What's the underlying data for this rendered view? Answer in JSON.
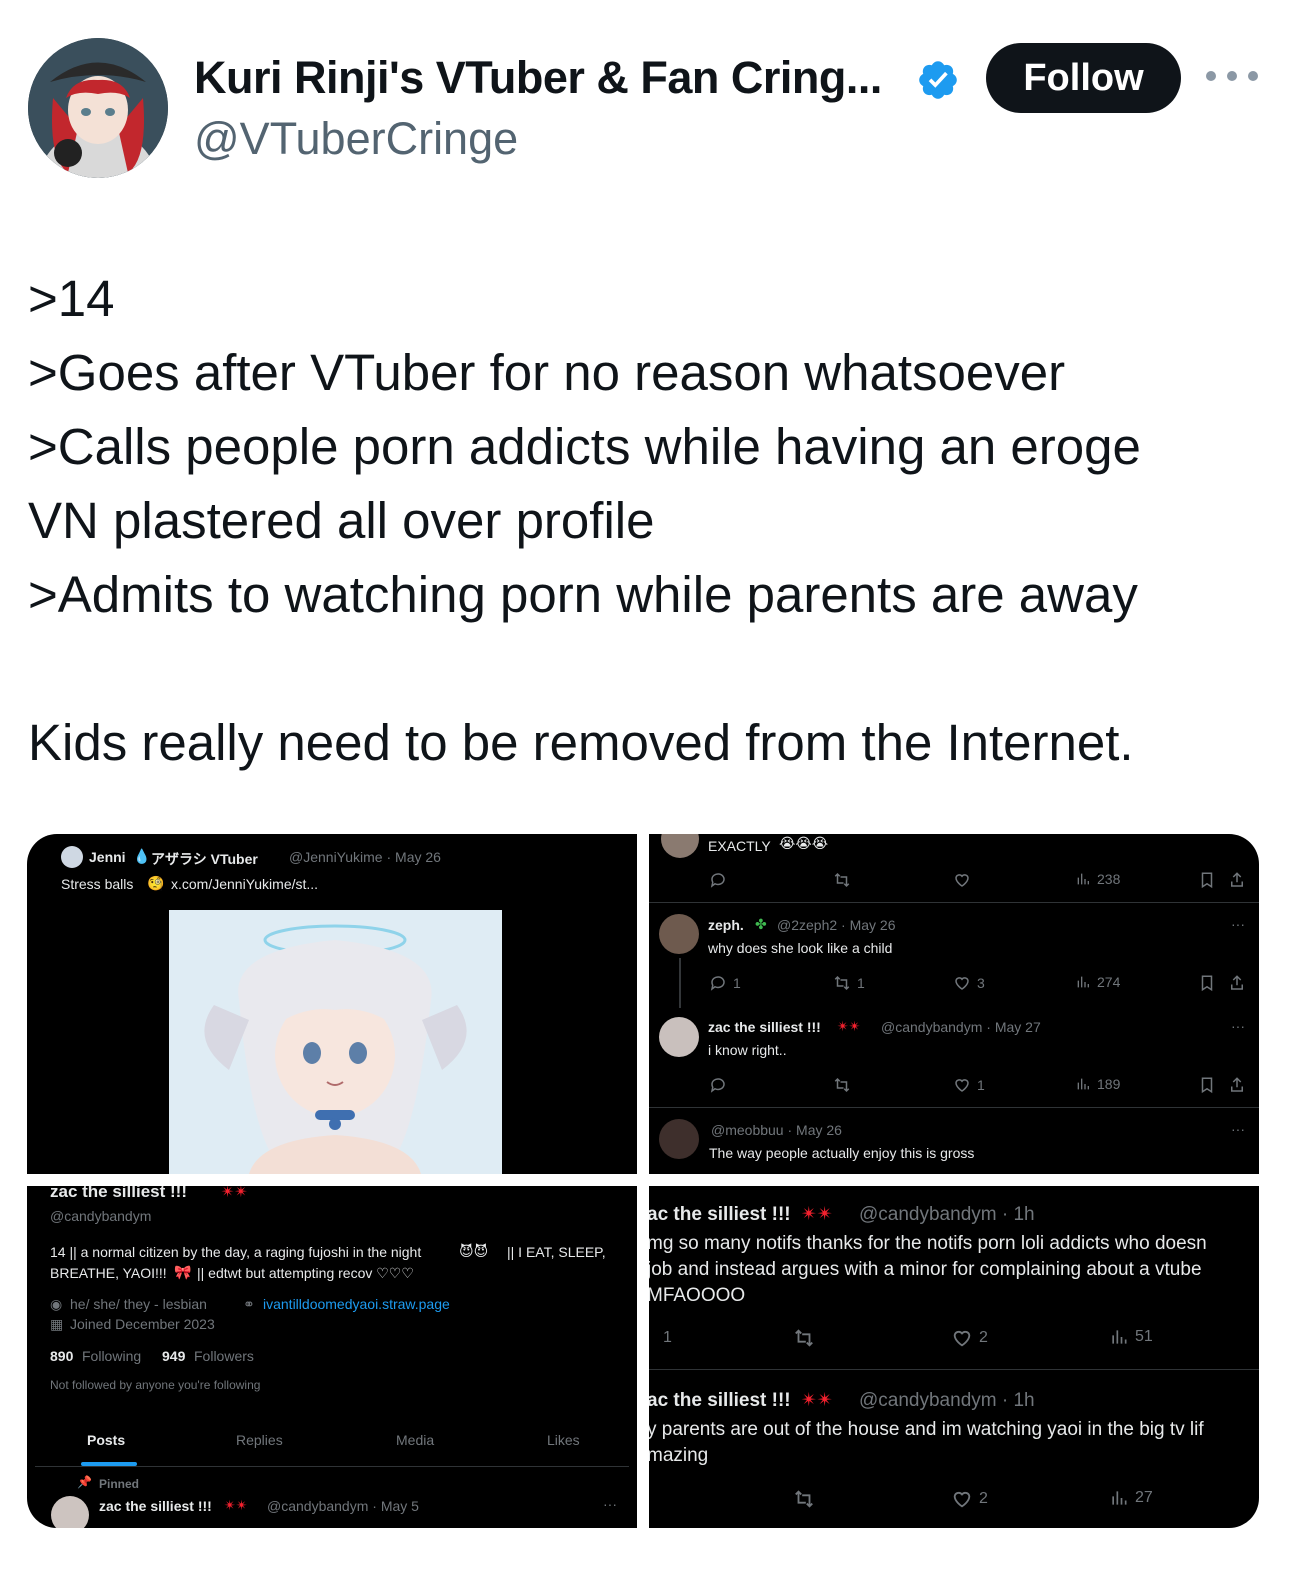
{
  "author": {
    "name": "Kuri Rinji's VTuber & Fan Cring...",
    "handle": "@VTuberCringe",
    "follow_label": "Follow"
  },
  "tweet": {
    "lines": [
      ">14",
      ">Goes after VTuber for no reason whatsoever",
      ">Calls people porn addicts while having an eroge",
      "VN plastered all over profile",
      ">Admits to watching porn while parents are away",
      "Kids really need to be removed from the Internet."
    ]
  },
  "media": {
    "tile1": {
      "name": "Jenni",
      "name_suffix": "アザラシ VTuber",
      "handle_date": "@JenniYukime · May 26",
      "text": "Stress balls",
      "link": "x.com/JenniYukime/st..."
    },
    "tile2": {
      "top_text": "EXACTLY",
      "top_views": "238",
      "replies": [
        {
          "name": "zeph.",
          "handle_date": "@2zeph2 · May 26",
          "text": "why does she look like a child",
          "reply_count": "1",
          "retweet_count": "1",
          "like_count": "3",
          "views": "274"
        },
        {
          "name": "zac the silliest !!!",
          "handle_date": "@candybandym · May 27",
          "text": "i know right..",
          "reply_count": "",
          "retweet_count": "",
          "like_count": "1",
          "views": "189"
        },
        {
          "name": "",
          "handle_date": "@meobbuu · May 26",
          "text": "The way people actually enjoy this is gross"
        }
      ]
    },
    "tile3": {
      "name": "zac the silliest !!!",
      "handle": "@candybandym",
      "bio_line1": "14 || a normal citizen by the day, a raging fujoshi in the night",
      "bio_line1_end": "|| I EAT, SLEEP,",
      "bio_line2": "BREATHE, YAOI!!!",
      "bio_line2_end": "|| edtwt but attempting recov ♡♡♡",
      "pronouns": "he/ she/ they - lesbian",
      "website": "ivantilldoomedyaoi.straw.page",
      "joined": "Joined December 2023",
      "following_count": "890",
      "following_label": "Following",
      "followers_count": "949",
      "followers_label": "Followers",
      "not_followed": "Not followed by anyone you're following",
      "tabs": [
        "Posts",
        "Replies",
        "Media",
        "Likes"
      ],
      "pinned_label": "Pinned",
      "pinned_name": "zac the silliest !!!",
      "pinned_handle_date": "@candybandym · May 5"
    },
    "tile4": {
      "posts": [
        {
          "name": "ac the silliest !!!",
          "handle_time": "@candybandym · 1h",
          "line1": "mg so many notifs thanks for the notifs porn loli addicts who doesn",
          "line2": "job and instead argues with a minor for complaining about a vtube",
          "line3": "MFAOOOO",
          "reply_count": "1",
          "like_count": "2",
          "views": "51"
        },
        {
          "name": "ac the silliest !!!",
          "handle_time": "@candybandym · 1h",
          "line1": "y parents are out of the house and im watching yaoi in the big tv lif",
          "line2": "mazing",
          "like_count": "2",
          "views": "27"
        }
      ]
    }
  },
  "colors": {
    "verified": "#1d9bf0",
    "follow_bg": "#0f1419",
    "muted": "#536471",
    "dark_bg": "#000000",
    "link": "#1d9bf0"
  }
}
